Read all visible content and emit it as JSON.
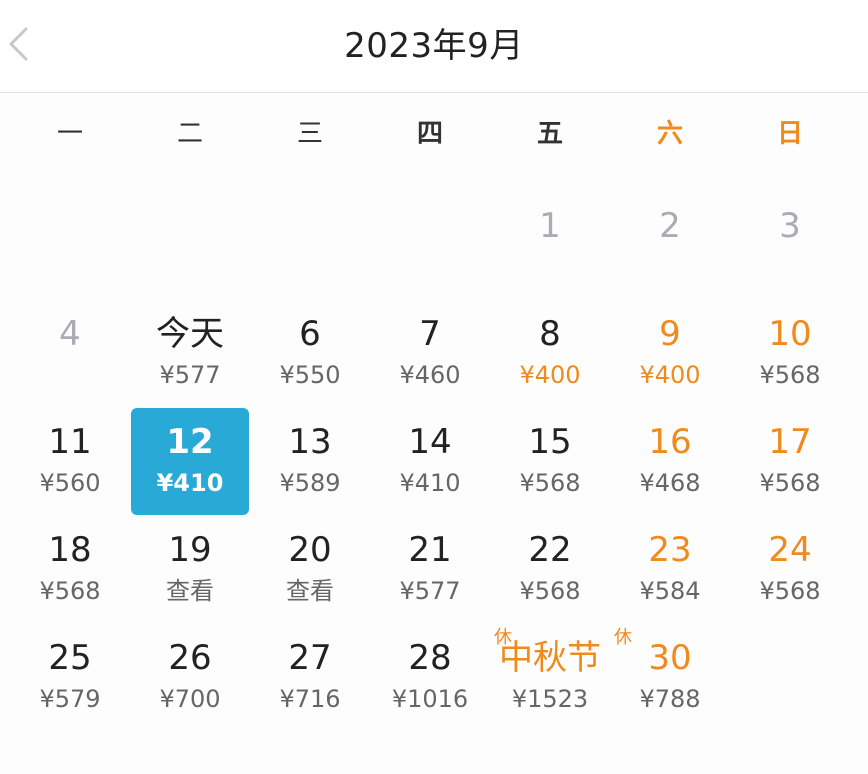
{
  "header": {
    "title": "2023年9月",
    "back_icon": "chevron-left-icon"
  },
  "weekdays": [
    "一",
    "二",
    "三",
    "四",
    "五",
    "六",
    "日"
  ],
  "colors": {
    "accent": "#28a9d6",
    "weekend": "#f08a1c",
    "muted": "#a9adb3"
  },
  "weeks": [
    [
      {
        "day": "",
        "price": ""
      },
      {
        "day": "",
        "price": ""
      },
      {
        "day": "",
        "price": ""
      },
      {
        "day": "",
        "price": ""
      },
      {
        "day": "1",
        "price": ""
      },
      {
        "day": "2",
        "price": ""
      },
      {
        "day": "3",
        "price": ""
      }
    ],
    [
      {
        "day": "4",
        "price": ""
      },
      {
        "day": "今天",
        "price": "¥577"
      },
      {
        "day": "6",
        "price": "¥550"
      },
      {
        "day": "7",
        "price": "¥460"
      },
      {
        "day": "8",
        "price": "¥400"
      },
      {
        "day": "9",
        "price": "¥400"
      },
      {
        "day": "10",
        "price": "¥568"
      }
    ],
    [
      {
        "day": "11",
        "price": "¥560"
      },
      {
        "day": "12",
        "price": "¥410"
      },
      {
        "day": "13",
        "price": "¥589"
      },
      {
        "day": "14",
        "price": "¥410"
      },
      {
        "day": "15",
        "price": "¥568"
      },
      {
        "day": "16",
        "price": "¥468"
      },
      {
        "day": "17",
        "price": "¥568"
      }
    ],
    [
      {
        "day": "18",
        "price": "¥568"
      },
      {
        "day": "19",
        "price": "查看"
      },
      {
        "day": "20",
        "price": "查看"
      },
      {
        "day": "21",
        "price": "¥577"
      },
      {
        "day": "22",
        "price": "¥568"
      },
      {
        "day": "23",
        "price": "¥584"
      },
      {
        "day": "24",
        "price": "¥568"
      }
    ],
    [
      {
        "day": "25",
        "price": "¥579"
      },
      {
        "day": "26",
        "price": "¥700"
      },
      {
        "day": "27",
        "price": "¥716"
      },
      {
        "day": "28",
        "price": "¥1016"
      },
      {
        "day": "中秋节",
        "price": "¥1523",
        "badge": "休"
      },
      {
        "day": "30",
        "price": "¥788",
        "badge": "休"
      },
      {
        "day": "",
        "price": ""
      }
    ]
  ]
}
